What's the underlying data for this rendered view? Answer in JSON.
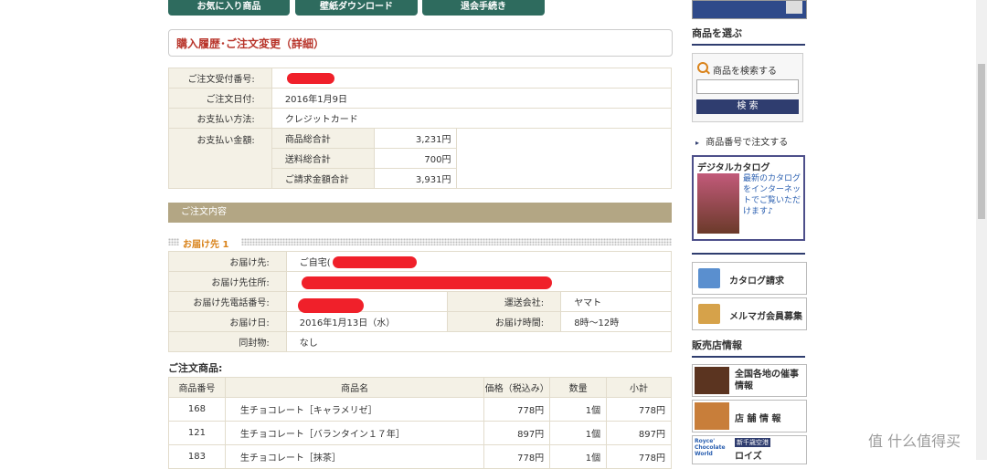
{
  "top_tabs": [
    "お気に入り商品",
    "壁紙ダウンロード",
    "退会手続き"
  ],
  "page_title": "購入履歴･ご注文変更（詳細）",
  "order_info": {
    "order_no_label": "ご注文受付番号:",
    "order_date_label": "ご注文日付:",
    "order_date": "2016年1月9日",
    "payment_method_label": "お支払い方法:",
    "payment_method": "クレジットカード",
    "amount_label": "お支払い金額:",
    "subtotal_label": "商品総合計",
    "subtotal": "3,231円",
    "shipping_label": "送料総合計",
    "shipping": "700円",
    "total_label": "ご請求金額合計",
    "total": "3,931円"
  },
  "section_title": "ご注文内容",
  "destination": {
    "heading": "お届け先 1",
    "name_label": "お届け先:",
    "name_value": "ご自宅(",
    "address_label": "お届け先住所:",
    "phone_label": "お届け先電話番号:",
    "carrier_label": "運送会社:",
    "carrier": "ヤマト",
    "delivery_date_label": "お届け日:",
    "delivery_date": "2016年1月13日（水）",
    "delivery_time_label": "お届け時間:",
    "delivery_time": "8時〜12時",
    "enclosure_label": "同封物:",
    "enclosure": "なし"
  },
  "order_items_label": "ご注文商品:",
  "items_headers": [
    "商品番号",
    "商品名",
    "価格（税込み）",
    "数量",
    "小計"
  ],
  "items": [
    {
      "no": "168",
      "name": "生チョコレート［キャラメリゼ］",
      "price": "778円",
      "qty": "1個",
      "subtotal": "778円"
    },
    {
      "no": "121",
      "name": "生チョコレート［バランタイン１７年］",
      "price": "897円",
      "qty": "1個",
      "subtotal": "897円"
    },
    {
      "no": "183",
      "name": "生チョコレート［抹茶］",
      "price": "778円",
      "qty": "1個",
      "subtotal": "778円"
    }
  ],
  "sidebar": {
    "choose_heading": "商品を選ぶ",
    "search_label": "商品を検索する",
    "search_button": "検 索",
    "order_by_number": "商品番号で注文する",
    "catalog_title": "デジタルカタログ",
    "catalog_text": "最新のカタログをインターネットでご覧いただけます♪",
    "catalog_request": "カタログ請求",
    "mailmag": "メルマガ会員募集",
    "shop_heading": "販売店情報",
    "events": "全国各地の催事情報",
    "stores": "店 舗 情 報",
    "airport_badge": "新千歳空港",
    "airport_brand": "ロイズ",
    "royce_logo": "Royce' Chocolate World"
  },
  "watermark": "值 什么值得买",
  "colors": {
    "tab_green": "#2e6b5e",
    "title_red": "#b8342a",
    "section_bar": "#b3a684",
    "label_bg": "#f4f1e6",
    "accent_orange": "#d9831b",
    "nav_blue": "#2f3d6f"
  }
}
